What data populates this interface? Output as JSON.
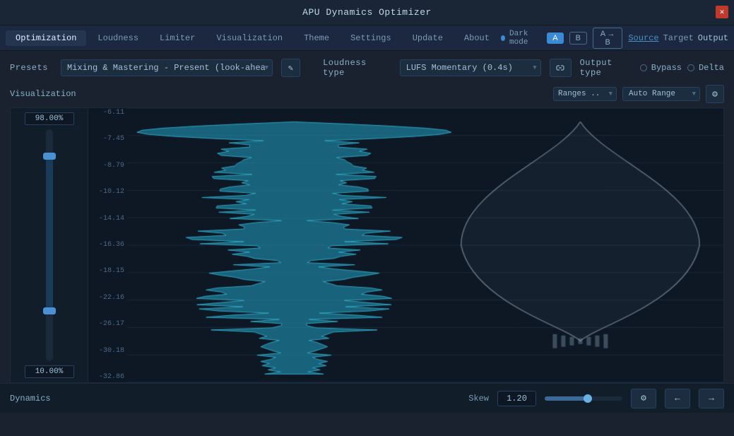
{
  "app": {
    "title": "APU Dynamics Optimizer"
  },
  "nav": {
    "items": [
      {
        "label": "Optimization",
        "active": true
      },
      {
        "label": "Loudness",
        "active": false
      },
      {
        "label": "Limiter",
        "active": false
      },
      {
        "label": "Visualization",
        "active": false
      },
      {
        "label": "Theme",
        "active": false
      },
      {
        "label": "Settings",
        "active": false
      },
      {
        "label": "Update",
        "active": false
      },
      {
        "label": "About",
        "active": false
      }
    ],
    "dark_mode_label": "Dark mode",
    "ab_a": "A",
    "ab_b": "B",
    "ab_ab": "A → B",
    "source": "Source",
    "target": "Target",
    "output": "Output"
  },
  "presets": {
    "label": "Presets",
    "value": "Mixing & Mastering - Present (look-ahead)",
    "edit_icon": "✎"
  },
  "loudness": {
    "label": "Loudness type",
    "value": "LUFS Momentary (0.4s)",
    "link_icon": "⬡"
  },
  "output_type": {
    "label": "Output type",
    "bypass": "Bypass",
    "delta": "Delta"
  },
  "visualization": {
    "label": "Visualization",
    "ranges_label": "Ranges ..",
    "auto_range": "Auto Range",
    "slider_top": "98.00%",
    "slider_bottom": "10.00%"
  },
  "y_axis": {
    "labels": [
      "-6.11",
      "-7.45",
      "-8.79",
      "-10.12",
      "-14.14",
      "-16.36",
      "-18.15",
      "-22.16",
      "-26.17",
      "-30.18",
      "-32.86"
    ]
  },
  "bottom_bar": {
    "dynamics_label": "Dynamics",
    "skew_label": "Skew",
    "skew_value": "1.20"
  }
}
